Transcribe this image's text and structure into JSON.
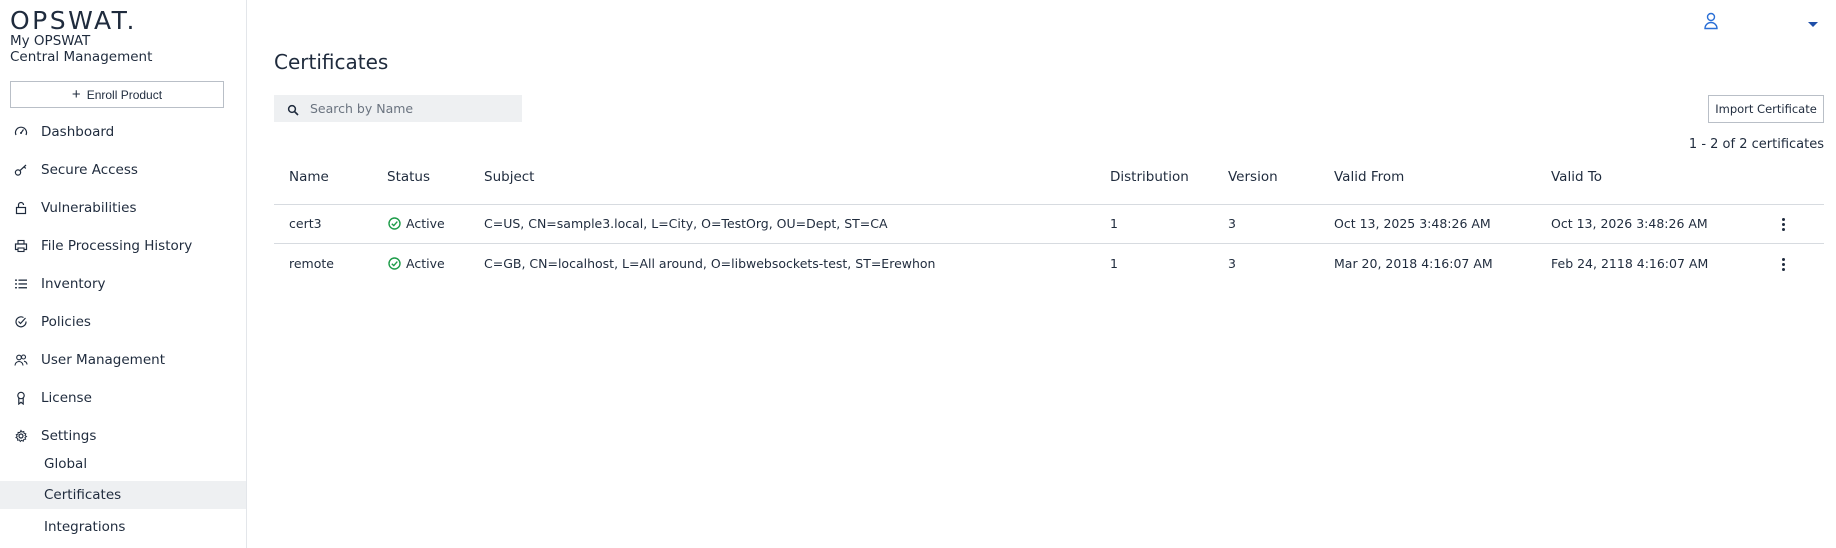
{
  "brand": {
    "logo_text": "OPSWAT.",
    "app_line1": "My OPSWAT",
    "app_line2": "Central Management"
  },
  "sidebar": {
    "enroll_label": "Enroll Product",
    "items": [
      {
        "label": "Dashboard",
        "icon": "gauge-icon"
      },
      {
        "label": "Secure Access",
        "icon": "key-icon"
      },
      {
        "label": "Vulnerabilities",
        "icon": "lock-icon"
      },
      {
        "label": "File Processing History",
        "icon": "printer-icon"
      },
      {
        "label": "Inventory",
        "icon": "list-icon"
      },
      {
        "label": "Policies",
        "icon": "shield-check-icon"
      },
      {
        "label": "User Management",
        "icon": "users-icon"
      },
      {
        "label": "License",
        "icon": "badge-icon"
      },
      {
        "label": "Settings",
        "icon": "gear-icon"
      }
    ],
    "settings_sub": [
      {
        "label": "Global"
      },
      {
        "label": "Certificates"
      },
      {
        "label": "Integrations"
      }
    ]
  },
  "main": {
    "title": "Certificates",
    "search_placeholder": "Search by Name",
    "import_label": "Import Certificate",
    "count_text": "1 - 2 of 2 certificates"
  },
  "table": {
    "columns": [
      "Name",
      "Status",
      "Subject",
      "Distribution",
      "Version",
      "Valid From",
      "Valid To"
    ],
    "rows": [
      {
        "name": "cert3",
        "status": "Active",
        "subject": "C=US, CN=sample3.local, L=City, O=TestOrg, OU=Dept, ST=CA",
        "distribution": "1",
        "version": "3",
        "valid_from": "Oct 13, 2025 3:48:26 AM",
        "valid_to": "Oct 13, 2026 3:48:26 AM"
      },
      {
        "name": "remote",
        "status": "Active",
        "subject": "C=GB, CN=localhost, L=All around, O=libwebsockets-test, ST=Erewhon",
        "distribution": "1",
        "version": "3",
        "valid_from": "Mar 20, 2018 4:16:07 AM",
        "valid_to": "Feb 24, 2118 4:16:07 AM"
      }
    ]
  },
  "colors": {
    "text": "#1f2b3d",
    "accent_user": "#2a6fd6",
    "status_active": "#1e9c4a",
    "selected_bg": "#eef0f2"
  }
}
